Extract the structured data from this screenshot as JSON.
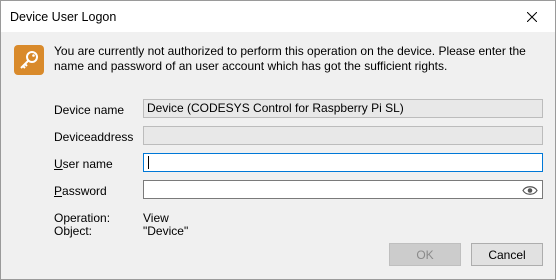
{
  "window": {
    "title": "Device User Logon"
  },
  "message": "You are currently not authorized to perform this operation on the device. Please enter the name and password of an user account which has got the sufficient rights.",
  "fields": {
    "device_name": {
      "label": "Device name",
      "value": "Device (CODESYS Control for Raspberry Pi SL)"
    },
    "device_address": {
      "label": "Deviceaddress",
      "value": ""
    },
    "user_name": {
      "label_mnemonic": "U",
      "label_rest": "ser name",
      "value": ""
    },
    "password": {
      "label_mnemonic": "P",
      "label_rest": "assword",
      "value": ""
    }
  },
  "info": {
    "operation_label": "Operation:",
    "operation_value": "View",
    "object_label": "Object:",
    "object_value": "\"Device\""
  },
  "buttons": {
    "ok": "OK",
    "cancel": "Cancel"
  },
  "icons": {
    "title_close": "close-icon",
    "key": "key-icon",
    "password_toggle": "eye-icon"
  },
  "colors": {
    "key_icon_bg": "#d98a2b",
    "focus_border": "#0078d7"
  }
}
